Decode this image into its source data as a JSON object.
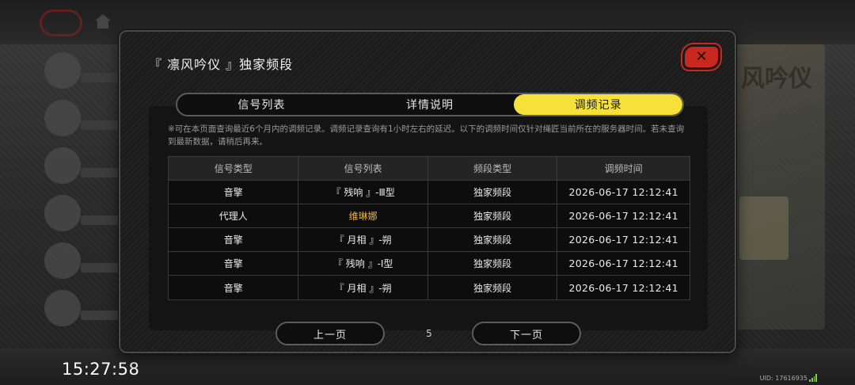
{
  "modal": {
    "title": "『 凛风吟仪 』独家频段",
    "close_icon": "close-x-icon"
  },
  "tabs": [
    {
      "label": "信号列表",
      "active": false
    },
    {
      "label": "详情说明",
      "active": false
    },
    {
      "label": "调频记录",
      "active": true
    }
  ],
  "note": "※可在本页面查询最近6个月内的调频记录。调频记录查询有1小时左右的延迟。以下的调频时间仅针对绳匠当前所在的服务器时间。若未查询到最新数据，请稍后再来。",
  "table": {
    "headers": [
      "信号类型",
      "信号列表",
      "频段类型",
      "调频时间"
    ],
    "rows": [
      {
        "type": "音擎",
        "item": "『 残响 』-Ⅲ型",
        "band": "独家频段",
        "time": "2026-06-17 12:12:41",
        "highlight": false
      },
      {
        "type": "代理人",
        "item": "维琳娜",
        "band": "独家频段",
        "time": "2026-06-17 12:12:41",
        "highlight": true
      },
      {
        "type": "音擎",
        "item": "『 月相 』-朔",
        "band": "独家频段",
        "time": "2026-06-17 12:12:41",
        "highlight": false
      },
      {
        "type": "音擎",
        "item": "『 残响 』-Ⅰ型",
        "band": "独家频段",
        "time": "2026-06-17 12:12:41",
        "highlight": false
      },
      {
        "type": "音擎",
        "item": "『 月相 』-朔",
        "band": "独家频段",
        "time": "2026-06-17 12:12:41",
        "highlight": false
      }
    ]
  },
  "pager": {
    "prev_label": "上一页",
    "page": "5",
    "next_label": "下一页"
  },
  "status": {
    "clock": "15:27:58",
    "uid": "UID: 17616935"
  },
  "background": {
    "right_panel_title": "风吟仪"
  },
  "colors": {
    "active_tab": "#f5e13a",
    "close_button": "#c8281e",
    "highlight_text": "#f0b43a"
  }
}
